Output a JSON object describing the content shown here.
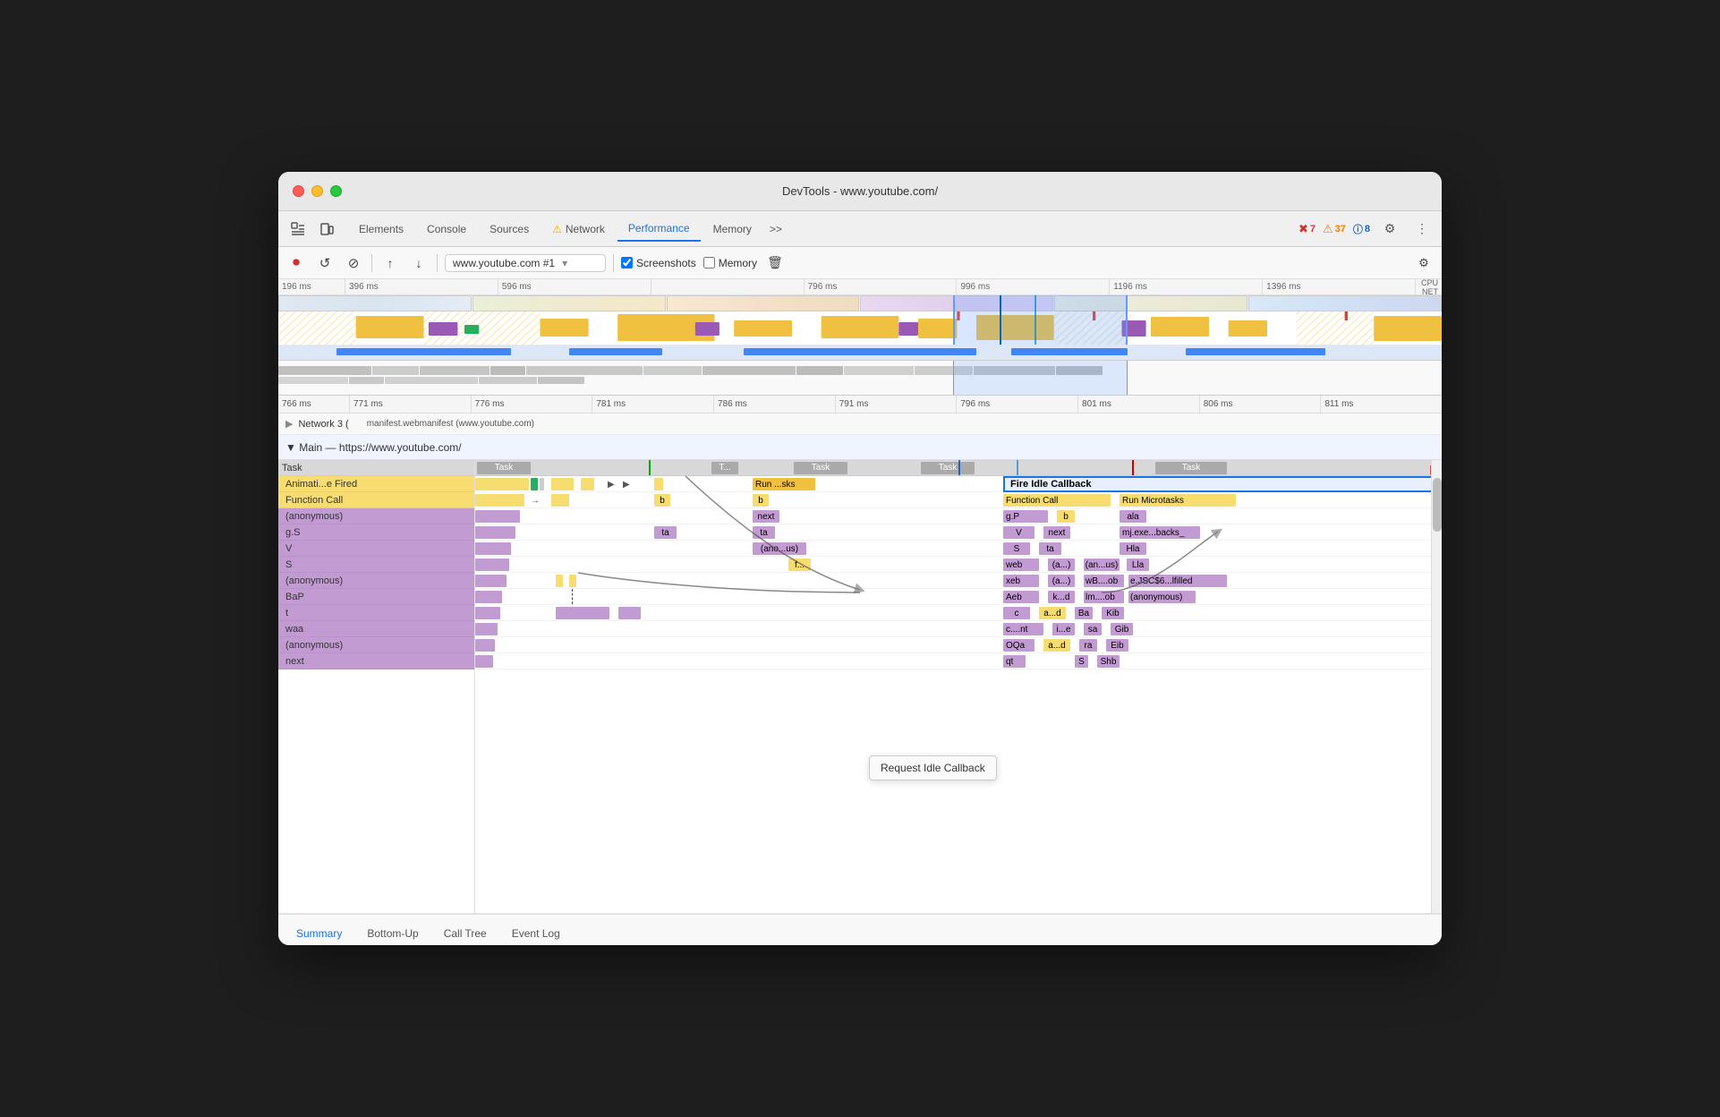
{
  "window": {
    "title": "DevTools - www.youtube.com/"
  },
  "traffic_lights": {
    "red_label": "close",
    "yellow_label": "minimize",
    "green_label": "maximize"
  },
  "tabs": {
    "items": [
      {
        "id": "elements",
        "label": "Elements",
        "active": false
      },
      {
        "id": "console",
        "label": "Console",
        "active": false
      },
      {
        "id": "sources",
        "label": "Sources",
        "active": false
      },
      {
        "id": "network",
        "label": "Network",
        "active": false,
        "has_warning": true
      },
      {
        "id": "performance",
        "label": "Performance",
        "active": true
      },
      {
        "id": "memory",
        "label": "Memory",
        "active": false
      }
    ],
    "more_label": ">>",
    "errors": {
      "red_count": "7",
      "yellow_count": "37",
      "blue_count": "8"
    }
  },
  "toolbar": {
    "record_label": "⏺",
    "refresh_label": "↺",
    "clear_label": "⊘",
    "upload_label": "↑",
    "download_label": "↓",
    "url_value": "www.youtube.com #1",
    "screenshots_label": "Screenshots",
    "memory_label": "Memory",
    "settings_icon": "⚙"
  },
  "timeline_ruler": {
    "ticks": [
      "196 ms",
      "396 ms",
      "596 ms",
      "796 ms",
      "996 ms",
      "1196 ms",
      "1396 ms"
    ]
  },
  "bottom_ruler": {
    "ticks": [
      "766 ms",
      "771 ms",
      "776 ms",
      "781 ms",
      "786 ms",
      "791 ms",
      "796 ms",
      "801 ms",
      "806 ms",
      "811 ms"
    ]
  },
  "network_track": {
    "label": "Network 3 (",
    "manifest_label": "manifest.webmanifest (www.youtube.com)"
  },
  "main_track": {
    "label": "▼ Main — https://www.youtube.com/"
  },
  "flame_rows": {
    "headers": [
      "Task",
      "",
      "",
      "T...",
      "",
      "Task",
      "Task",
      "",
      "Task"
    ],
    "left_labels": [
      "Animati...e Fired",
      "Function Call",
      "(anonymous)",
      "g.S",
      "V",
      "S",
      "(anonymous)",
      "BaP",
      "t",
      "waa",
      "(anonymous)",
      "next"
    ],
    "middle_col": [
      {
        "label": "Run ...sks",
        "color": "yellow"
      },
      {
        "label": "b",
        "color": "yellow"
      },
      {
        "label": "next",
        "color": "purple"
      },
      {
        "label": "ta",
        "color": "purple"
      },
      {
        "label": "(ano...us)",
        "color": "purple"
      },
      {
        "label": "f...",
        "color": "yellow"
      }
    ],
    "right_section": {
      "header": "Fire Idle Callback",
      "rows": [
        {
          "col1": "",
          "col2": "Function Call",
          "col3": "Run Microtasks"
        },
        {
          "col1": "g.P",
          "col2": "b",
          "col3": "ala"
        },
        {
          "col1": "V",
          "col2": "next",
          "col3": "mj.exe...backs_"
        },
        {
          "col1": "S",
          "col2": "ta",
          "col3": "Hla"
        },
        {
          "col1": "web",
          "col2": "(a...)",
          "col3": "(an...us)",
          "col4": "Lla"
        },
        {
          "col1": "xeb",
          "col2": "(a...)",
          "col3": "wB....ob",
          "col4": "e.JSC$6...lfilled"
        },
        {
          "col1": "Aeb",
          "col2": "k...d",
          "col3": "lm....ob",
          "col4": "(anonymous)"
        },
        {
          "col1": "c",
          "col2": "a...d",
          "col3": "Ba",
          "col4": "Kib"
        },
        {
          "col1": "c....nt",
          "col2": "i...e",
          "col3": "sa",
          "col4": "Gib"
        },
        {
          "col1": "OQa",
          "col2": "a...d",
          "col3": "ra",
          "col4": "Eib"
        },
        {
          "col1": "qt",
          "col2": "",
          "col3": "S",
          "col4": "Shb"
        }
      ]
    }
  },
  "tooltip": {
    "label": "Request Idle Callback"
  },
  "bottom_tabs": {
    "items": [
      {
        "id": "summary",
        "label": "Summary",
        "active": true
      },
      {
        "id": "bottom-up",
        "label": "Bottom-Up",
        "active": false
      },
      {
        "id": "call-tree",
        "label": "Call Tree",
        "active": false
      },
      {
        "id": "event-log",
        "label": "Event Log",
        "active": false
      }
    ]
  },
  "colors": {
    "scripting": "#f0c040",
    "rendering": "#9b59b6",
    "painting": "#27ae60",
    "task_gray": "#aaaaaa",
    "selected_blue": "#1a73e8",
    "purple_light": "#c39bd3",
    "yellow_light": "#f7dc6f"
  }
}
